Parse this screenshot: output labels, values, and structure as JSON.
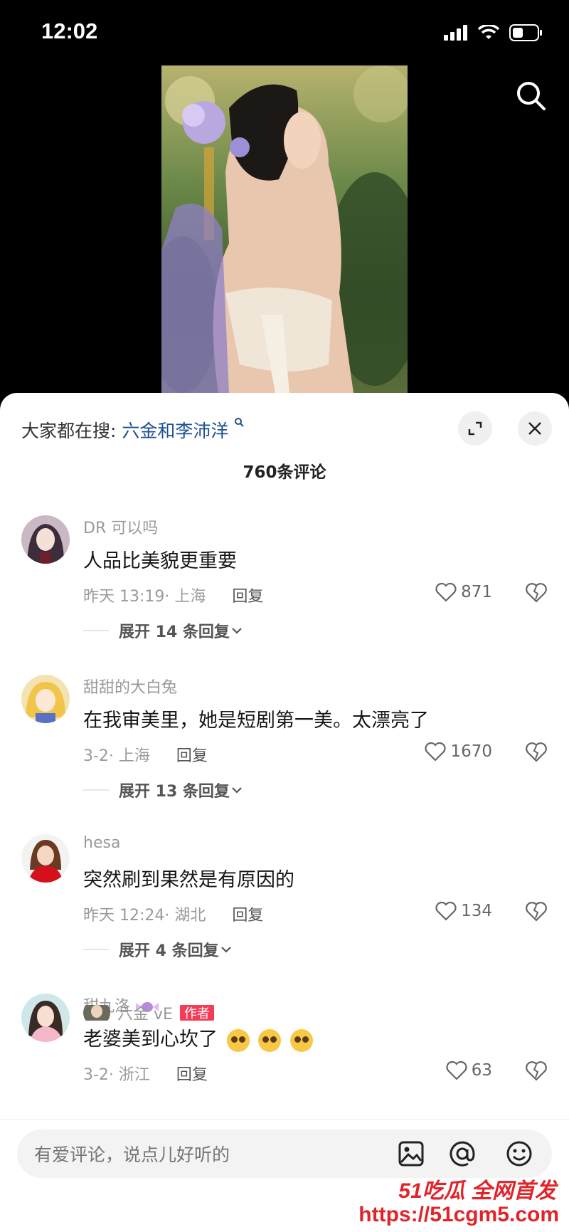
{
  "status_bar": {
    "time": "12:02"
  },
  "hot_search": {
    "prefix": "大家都在搜:",
    "keyword": "六金和李沛洋"
  },
  "comments_count": "760条评论",
  "comments": [
    {
      "user": "DR 可以吗",
      "text": "人品比美貌更重要",
      "time_location": "昨天 13:19· 上海",
      "reply": "回复",
      "likes": "871",
      "expand": "展开 14 条回复"
    },
    {
      "user": "甜甜的大白兔",
      "text": "在我审美里，她是短剧第一美。太漂亮了",
      "time_location": "3-2· 上海",
      "reply": "回复",
      "likes": "1670",
      "expand": "展开 13 条回复"
    },
    {
      "user": "hesa",
      "text": "突然刷到果然是有原因的",
      "time_location": "昨天 12:24· 湖北",
      "reply": "回复",
      "likes": "134",
      "expand": "展开 4 条回复"
    },
    {
      "user": "甜九洛",
      "text": "老婆美到心坎了",
      "time_location": "3-2· 浙江",
      "reply": "回复",
      "likes": "63"
    }
  ],
  "partial_reply": {
    "user": "六金 vE",
    "badge": "作者"
  },
  "input": {
    "placeholder": "有爱评论，说点儿好听的"
  },
  "watermark": {
    "top": "51吃瓜 全网首发",
    "url": "https://51cgm5.com"
  }
}
